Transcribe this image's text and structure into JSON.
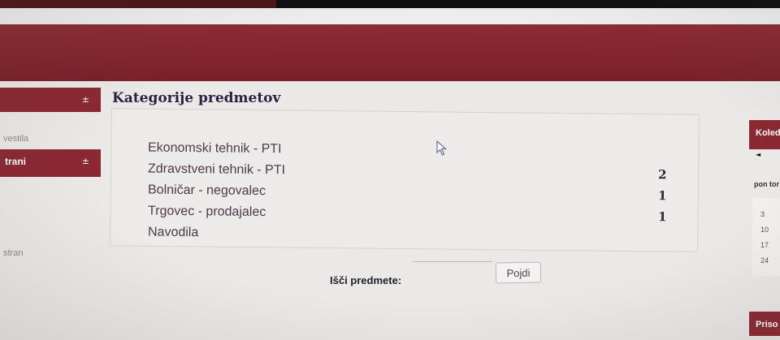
{
  "left_sidebar": {
    "block1": {
      "title": "",
      "toggle": "±"
    },
    "link1": "vestila",
    "block2": {
      "title": "trani",
      "toggle": "±"
    },
    "link2": "stran"
  },
  "main": {
    "title": "Kategorije predmetov",
    "categories": [
      {
        "name": "Ekonomski tehnik - PTI",
        "count": ""
      },
      {
        "name": "Zdravstveni tehnik - PTI",
        "count": "2"
      },
      {
        "name": "Bolničar - negovalec",
        "count": "1"
      },
      {
        "name": "Trgovec - prodajalec",
        "count": "1"
      },
      {
        "name": "Navodila",
        "count": ""
      }
    ]
  },
  "search": {
    "label": "Išči predmete:",
    "input_value": "",
    "button_label": "Pojdi"
  },
  "right_sidebar": {
    "calendar_title": "Koledar",
    "calendar_prev": "◄",
    "calendar_dayhead": "pon tor",
    "calendar_days": [
      "3",
      "10",
      "17",
      "24"
    ],
    "attachments_title": "Priso"
  },
  "colors": {
    "brand": "#8b2832",
    "banner": "#7a1f28",
    "page_bg": "#ebe9e8"
  }
}
